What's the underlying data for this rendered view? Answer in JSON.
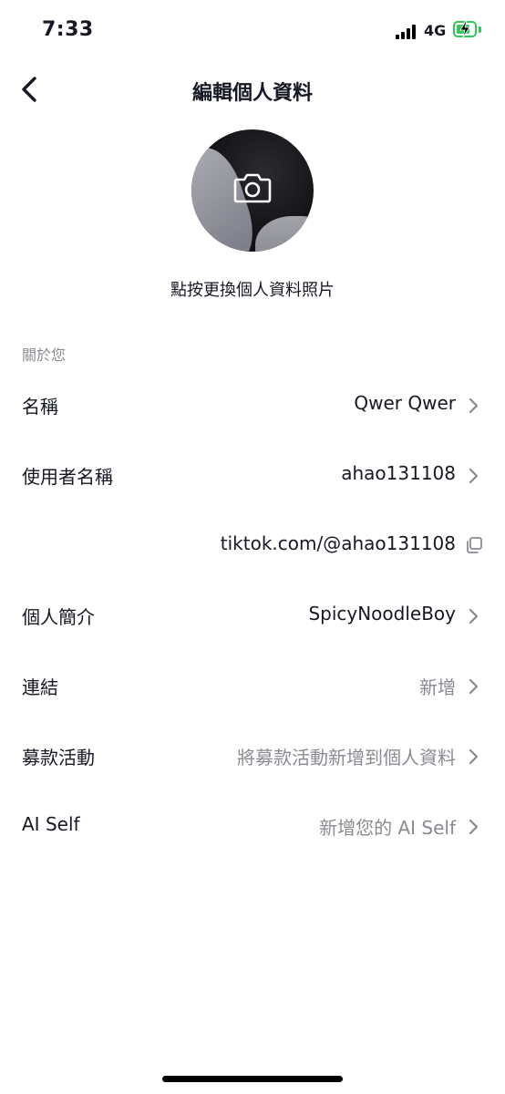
{
  "status_bar": {
    "time": "7:33",
    "network": "4G",
    "battery_color": "#34c759"
  },
  "header": {
    "title": "編輯個人資料",
    "back_icon": "chevron-left-icon"
  },
  "avatar": {
    "change_label": "點按更換個人資料照片",
    "icon": "camera-icon"
  },
  "about": {
    "section_label": "關於您",
    "rows": [
      {
        "label": "名稱",
        "value": "Qwer Qwer"
      },
      {
        "label": "使用者名稱",
        "value": "ahao131108"
      },
      {
        "label": "",
        "value": "tiktok.com/@ahao131108"
      },
      {
        "label": "個人簡介",
        "value": "SpicyNoodleBoy"
      },
      {
        "label": "連結",
        "value": "新增"
      },
      {
        "label": "募款活動",
        "value": "將募款活動新增到個人資料"
      },
      {
        "label": "AI Self",
        "value": "新增您的 AI Self"
      }
    ]
  },
  "colors": {
    "text": "#161823",
    "muted": "#8a8b91",
    "background": "#ffffff"
  }
}
